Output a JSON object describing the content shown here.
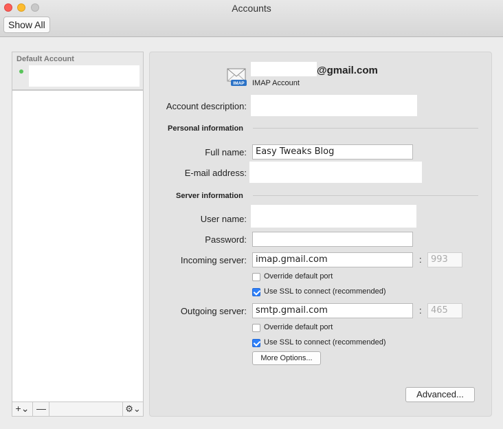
{
  "window": {
    "title": "Accounts"
  },
  "toolbar": {
    "show_all_label": "Show All"
  },
  "sidebar": {
    "header_label": "Default Account",
    "add_label": "+⌄",
    "remove_label": "—",
    "gear_label": "⚙⌄"
  },
  "account": {
    "email_suffix": "@gmail.com",
    "type_label": "IMAP Account",
    "icon_badge": "IMAP"
  },
  "form": {
    "description_label": "Account description:",
    "personal_section": "Personal information",
    "fullname_label": "Full name:",
    "fullname_value": "Easy Tweaks Blog",
    "email_label": "E-mail address:",
    "server_section": "Server information",
    "username_label": "User name:",
    "password_label": "Password:",
    "incoming_label": "Incoming server:",
    "incoming_value": "imap.gmail.com",
    "incoming_port": "993",
    "outgoing_label": "Outgoing server:",
    "outgoing_value": "smtp.gmail.com",
    "outgoing_port": "465",
    "colon": ":",
    "override_port_label": "Override default port",
    "use_ssl_label": "Use SSL to connect (recommended)",
    "incoming_override_checked": false,
    "incoming_ssl_checked": true,
    "outgoing_override_checked": false,
    "outgoing_ssl_checked": true,
    "more_options_label": "More Options...",
    "advanced_label": "Advanced..."
  }
}
